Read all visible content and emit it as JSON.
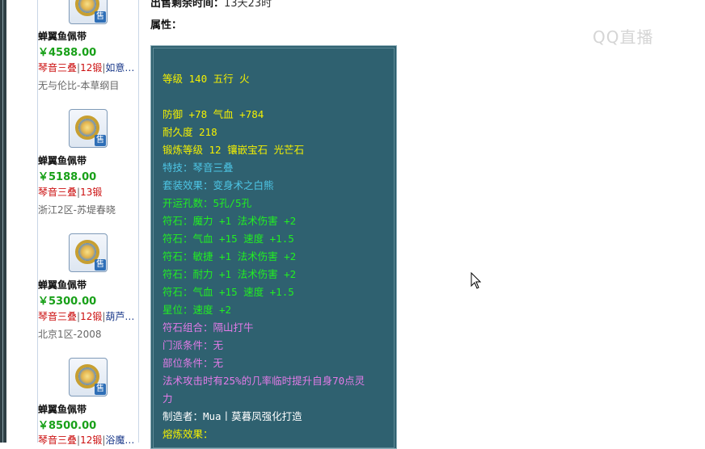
{
  "header": {
    "remaining_label": "出售剩余时间：",
    "remaining_value": "13天23时",
    "attributes_label": "属性："
  },
  "watermark": "QQ直播",
  "sidebar": {
    "items": [
      {
        "name": "蝉翼鱼佩带",
        "price": "￥4588.00",
        "tags": [
          "琴音三叠",
          "12锻",
          "如意"
        ],
        "server": "无与伦比-本草纲目"
      },
      {
        "name": "蝉翼鱼佩带",
        "price": "￥5188.00",
        "tags": [
          "琴音三叠",
          "13锻"
        ],
        "server": "浙江2区-苏堤春晓"
      },
      {
        "name": "蝉翼鱼佩带",
        "price": "￥5300.00",
        "tags": [
          "琴音三叠",
          "12锻",
          "葫芦"
        ],
        "server": "北京1区-2008"
      },
      {
        "name": "蝉翼鱼佩带",
        "price": "￥8500.00",
        "tags": [
          "琴音三叠",
          "12锻",
          "浴魔"
        ],
        "server": ""
      }
    ],
    "sale_tag": "售"
  },
  "attributes": [
    {
      "text": "等级 140 五行 火",
      "color": "yellow"
    },
    {
      "text": "防御 +78 气血 +784",
      "color": "yellow"
    },
    {
      "text": "耐久度 218",
      "color": "yellow"
    },
    {
      "text": "锻炼等级 12 镶嵌宝石 光芒石",
      "color": "yellow"
    },
    {
      "text": "特技：琴音三叠",
      "color": "cyan"
    },
    {
      "text": "套装效果：变身术之白熊",
      "color": "cyan"
    },
    {
      "text": "开运孔数：5孔/5孔",
      "color": "green"
    },
    {
      "text": "符石：魔力 +1 法术伤害 +2",
      "color": "green"
    },
    {
      "text": "符石：气血 +15 速度 +1.5",
      "color": "green"
    },
    {
      "text": "符石：敏捷 +1 法术伤害 +2",
      "color": "green"
    },
    {
      "text": "符石：耐力 +1 法术伤害 +2",
      "color": "green"
    },
    {
      "text": "符石：气血 +15 速度 +1.5",
      "color": "green"
    },
    {
      "text": "星位：速度 +2",
      "color": "green"
    },
    {
      "text": "符石组合：隔山打牛",
      "color": "pink"
    },
    {
      "text": "门派条件：无",
      "color": "pink"
    },
    {
      "text": "部位条件：无",
      "color": "pink"
    },
    {
      "text": "法术攻击时有25%的几率临时提升自身70点灵",
      "color": "pink"
    },
    {
      "text": "力",
      "color": "pink"
    },
    {
      "text": "制造者：Mua丨莫暮凤强化打造",
      "color": "white"
    },
    {
      "text": "熔炼效果：",
      "color": "yellow"
    }
  ],
  "colors": {
    "panel_bg": "#2f6170",
    "yellow": "#f4f000",
    "cyan": "#4ec6e6",
    "green": "#22ee22",
    "pink": "#e37be8",
    "white": "#ffffff",
    "price": "#18a018"
  }
}
